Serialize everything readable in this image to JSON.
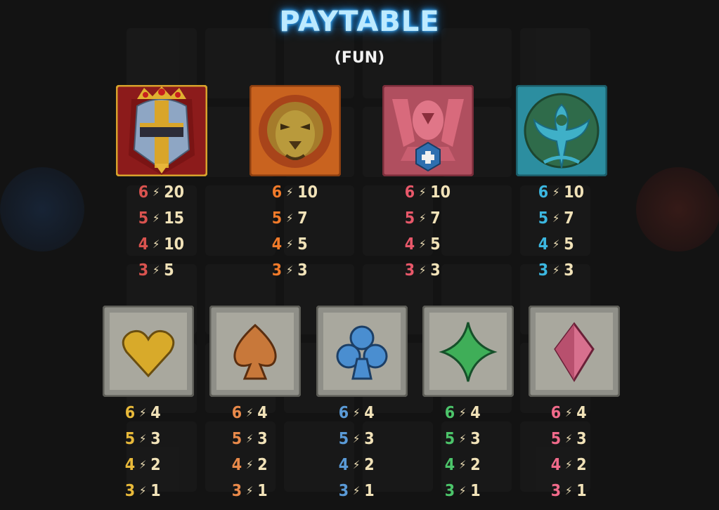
{
  "title": "PAYTABLE",
  "subtitle": "(FUN)",
  "bolt_glyph": "⚡",
  "premium_symbols": [
    {
      "name": "knight-helmet",
      "icon": "knight-helmet-icon",
      "color": "#d9534f",
      "pays": [
        {
          "count": "6",
          "value": "20"
        },
        {
          "count": "5",
          "value": "15"
        },
        {
          "count": "4",
          "value": "10"
        },
        {
          "count": "3",
          "value": "5"
        }
      ]
    },
    {
      "name": "lion",
      "icon": "lion-icon",
      "color": "#f07a2a",
      "pays": [
        {
          "count": "6",
          "value": "10"
        },
        {
          "count": "5",
          "value": "7"
        },
        {
          "count": "4",
          "value": "5"
        },
        {
          "count": "3",
          "value": "3"
        }
      ]
    },
    {
      "name": "eagle",
      "icon": "eagle-icon",
      "color": "#e8586a",
      "pays": [
        {
          "count": "6",
          "value": "10"
        },
        {
          "count": "5",
          "value": "7"
        },
        {
          "count": "4",
          "value": "5"
        },
        {
          "count": "3",
          "value": "3"
        }
      ]
    },
    {
      "name": "tree",
      "icon": "tree-icon",
      "color": "#3cb7e0",
      "pays": [
        {
          "count": "6",
          "value": "10"
        },
        {
          "count": "5",
          "value": "7"
        },
        {
          "count": "4",
          "value": "5"
        },
        {
          "count": "3",
          "value": "3"
        }
      ]
    }
  ],
  "card_symbols": [
    {
      "name": "heart",
      "icon": "heart-icon",
      "color": "#e8b93a",
      "pays": [
        {
          "count": "6",
          "value": "4"
        },
        {
          "count": "5",
          "value": "3"
        },
        {
          "count": "4",
          "value": "2"
        },
        {
          "count": "3",
          "value": "1"
        }
      ]
    },
    {
      "name": "spade",
      "icon": "spade-icon",
      "color": "#e8894a",
      "pays": [
        {
          "count": "6",
          "value": "4"
        },
        {
          "count": "5",
          "value": "3"
        },
        {
          "count": "4",
          "value": "2"
        },
        {
          "count": "3",
          "value": "1"
        }
      ]
    },
    {
      "name": "club",
      "icon": "club-icon",
      "color": "#5a9ad6",
      "pays": [
        {
          "count": "6",
          "value": "4"
        },
        {
          "count": "5",
          "value": "3"
        },
        {
          "count": "4",
          "value": "2"
        },
        {
          "count": "3",
          "value": "1"
        }
      ]
    },
    {
      "name": "diamond",
      "icon": "diamond-icon",
      "color": "#4cc46a",
      "pays": [
        {
          "count": "6",
          "value": "4"
        },
        {
          "count": "5",
          "value": "3"
        },
        {
          "count": "4",
          "value": "2"
        },
        {
          "count": "3",
          "value": "1"
        }
      ]
    },
    {
      "name": "crystal",
      "icon": "crystal-icon",
      "color": "#f06a8a",
      "pays": [
        {
          "count": "6",
          "value": "4"
        },
        {
          "count": "5",
          "value": "3"
        },
        {
          "count": "4",
          "value": "2"
        },
        {
          "count": "3",
          "value": "1"
        }
      ]
    }
  ]
}
